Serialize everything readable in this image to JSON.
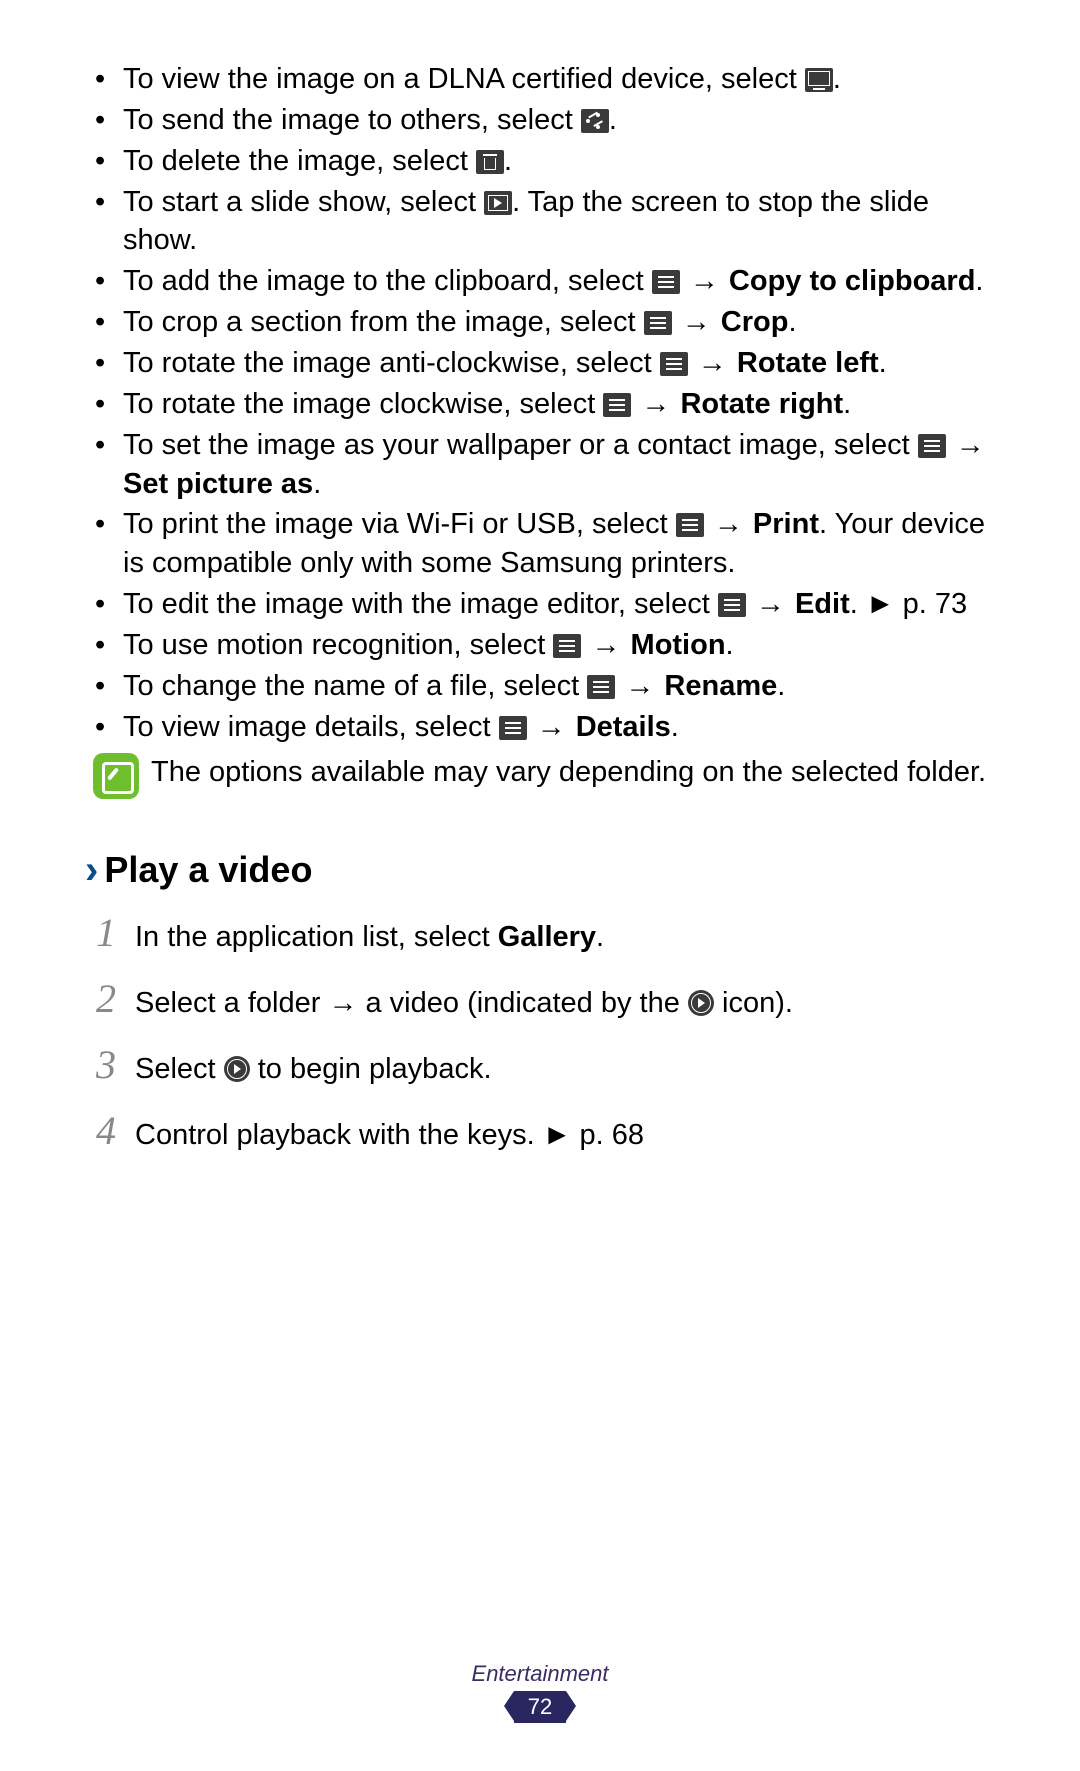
{
  "bullets": [
    {
      "pre": "To view the image on a DLNA certified device, select ",
      "icon": "dlna-icon",
      "post": ".",
      "bold1": "",
      "post2": ""
    },
    {
      "pre": "To send the image to others, select ",
      "icon": "share-icon",
      "post": ".",
      "bold1": "",
      "post2": ""
    },
    {
      "pre": "To delete the image, select ",
      "icon": "trash-icon",
      "post": ".",
      "bold1": "",
      "post2": ""
    },
    {
      "pre": "To start a slide show, select ",
      "icon": "slideshow-icon",
      "post": ". Tap the screen to stop the slide show.",
      "bold1": "",
      "post2": ""
    },
    {
      "pre": "To add the image to the clipboard, select ",
      "icon": "menu-icon",
      "post": " → ",
      "bold1": "Copy to clipboard",
      "post2": "."
    },
    {
      "pre": "To crop a section from the image, select ",
      "icon": "menu-icon",
      "post": " → ",
      "bold1": "Crop",
      "post2": "."
    },
    {
      "pre": "To rotate the image anti-clockwise, select ",
      "icon": "menu-icon",
      "post": " → ",
      "bold1": "Rotate left",
      "post2": "."
    },
    {
      "pre": "To rotate the image clockwise, select ",
      "icon": "menu-icon",
      "post": " → ",
      "bold1": "Rotate right",
      "post2": "."
    },
    {
      "pre": "To set the image as your wallpaper or a contact image, select ",
      "icon": "menu-icon",
      "post": " → ",
      "bold1": "Set picture as",
      "post2": "."
    },
    {
      "pre": "To print the image via Wi-Fi or USB, select ",
      "icon": "menu-icon",
      "post": " → ",
      "bold1": "Print",
      "post2": ". Your device is compatible only with some Samsung printers."
    },
    {
      "pre": "To edit the image with the image editor, select ",
      "icon": "menu-icon",
      "post": " → ",
      "bold1": "Edit",
      "post2": ". ► p. 73"
    },
    {
      "pre": "To use motion recognition, select ",
      "icon": "menu-icon",
      "post": " → ",
      "bold1": "Motion",
      "post2": "."
    },
    {
      "pre": "To change the name of a file, select ",
      "icon": "menu-icon",
      "post": " → ",
      "bold1": "Rename",
      "post2": "."
    },
    {
      "pre": "To view image details, select ",
      "icon": "menu-icon",
      "post": " → ",
      "bold1": "Details",
      "post2": "."
    }
  ],
  "note": "The options available may vary depending on the selected folder.",
  "heading": "Play a video",
  "steps": {
    "s1a": "In the application list, select ",
    "s1b": "Gallery",
    "s1c": ".",
    "s2a": "Select a folder → a video (indicated by the ",
    "s2b": " icon).",
    "s3a": "Select ",
    "s3b": " to begin playback.",
    "s4": "Control playback with the keys. ► p. 68"
  },
  "footer_label": "Entertainment",
  "page_number": "72"
}
